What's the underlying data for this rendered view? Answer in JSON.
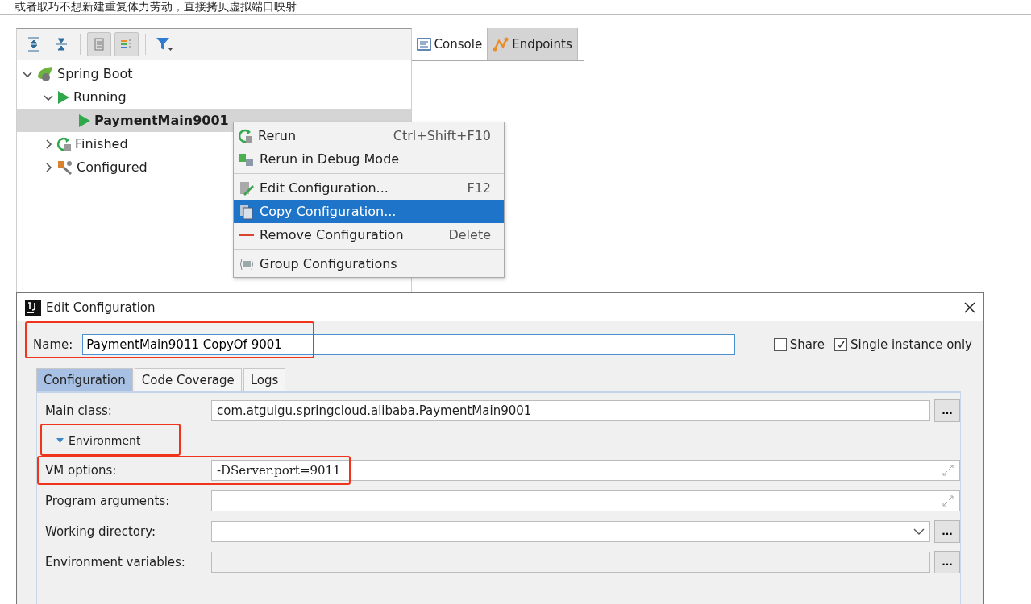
{
  "caption": "或者取巧不想新建重复体力劳动，直接拷贝虚拟端口映射",
  "toolbar": [
    {
      "kind": "expand-all",
      "pressed": false
    },
    {
      "kind": "collapse-all",
      "pressed": false
    },
    {
      "kind": "group-status",
      "pressed": true
    },
    {
      "kind": "group-type",
      "pressed": true
    },
    {
      "kind": "filter",
      "pressed": false
    }
  ],
  "tabs": [
    {
      "label": "Console",
      "kind": "console",
      "selected": true
    },
    {
      "label": "Endpoints",
      "kind": "endpoints",
      "selected": false
    }
  ],
  "tree": [
    {
      "label": "Spring Boot",
      "kind": "spring",
      "expanded": true,
      "selected": false,
      "children": [
        {
          "label": "Running",
          "kind": "run",
          "expanded": true,
          "selected": false,
          "children": [
            {
              "label": "PaymentMain9001",
              "kind": "run",
              "selected": true
            }
          ]
        },
        {
          "label": "Finished",
          "kind": "rerun",
          "expanded": false,
          "selected": false
        },
        {
          "label": "Configured",
          "kind": "config",
          "expanded": false,
          "selected": false
        }
      ]
    }
  ],
  "context_menu": [
    [
      {
        "label": "Rerun",
        "kind": "rerun",
        "shortcut": "Ctrl+Shift+F10",
        "selected": false
      },
      {
        "label": "Rerun in Debug Mode",
        "kind": "debug",
        "selected": false
      }
    ],
    [
      {
        "label": "Edit Configuration...",
        "kind": "edit",
        "shortcut": "F12",
        "selected": false
      },
      {
        "label": "Copy Configuration...",
        "kind": "copy",
        "selected": true
      },
      {
        "label": "Remove Configuration",
        "kind": "remove",
        "shortcut": "Delete",
        "selected": false
      }
    ],
    [
      {
        "label": "Group Configurations",
        "kind": "group",
        "selected": false
      }
    ]
  ],
  "dialog": {
    "title": "Edit Configuration",
    "name": {
      "label": "Name:",
      "value": "PaymentMain9011 CopyOf 9001",
      "highlighted": true
    },
    "options": [
      {
        "label": "Share",
        "checked": false
      },
      {
        "label": "Single instance only",
        "checked": true
      }
    ],
    "tabs": [
      {
        "label": "Configuration",
        "selected": true
      },
      {
        "label": "Code Coverage",
        "selected": false
      },
      {
        "label": "Logs",
        "selected": false
      }
    ],
    "main_class": {
      "label": "Main class:",
      "value": "com.atguigu.springcloud.alibaba.PaymentMain9001",
      "kind": "browse",
      "button": "..."
    },
    "section": {
      "label": "Environment",
      "expanded": true,
      "highlighted": true
    },
    "fields": [
      {
        "label": "VM options:",
        "value": "-DServer.port=9011",
        "kind": "expandable",
        "highlighted": true
      },
      {
        "label": "Program arguments:",
        "kind": "expandable",
        "highlighted": false
      },
      {
        "label": "Working directory:",
        "kind": "dropdown",
        "highlighted": false,
        "button": "..."
      },
      {
        "label": "Environment variables:",
        "kind": "browse",
        "disabled": true,
        "highlighted": false,
        "button": "..."
      }
    ]
  }
}
